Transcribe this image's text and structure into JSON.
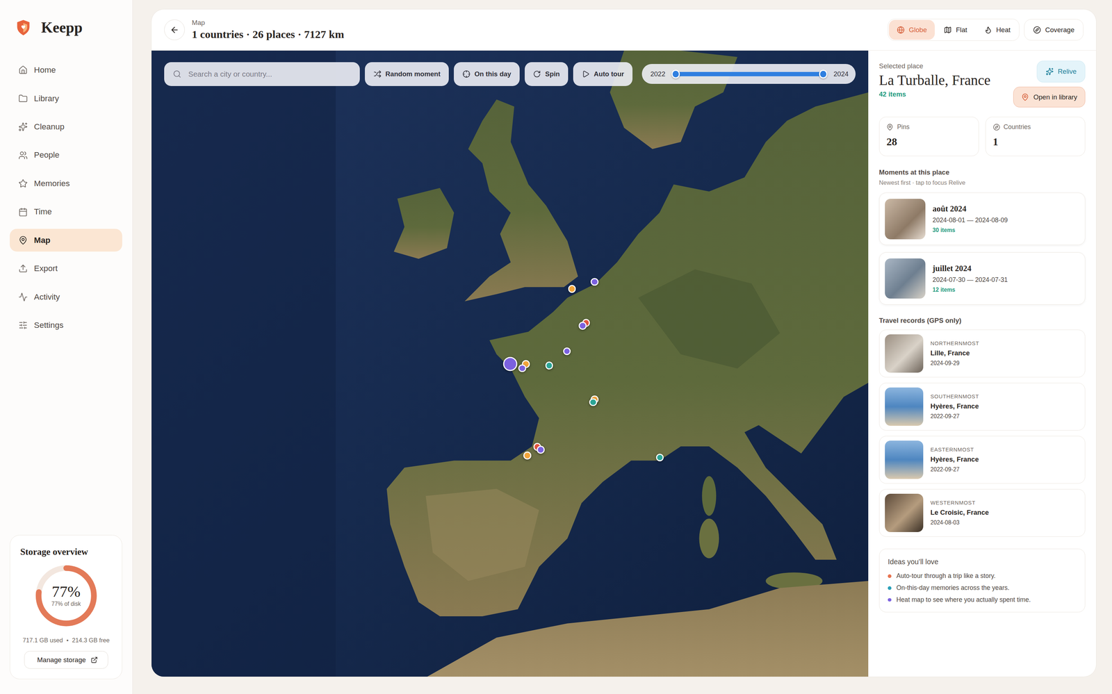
{
  "app": {
    "name": "Keepp"
  },
  "sidebar": {
    "items": [
      {
        "label": "Home",
        "selected": false
      },
      {
        "label": "Library",
        "selected": false
      },
      {
        "label": "Cleanup",
        "selected": false
      },
      {
        "label": "People",
        "selected": false
      },
      {
        "label": "Memories",
        "selected": false
      },
      {
        "label": "Time",
        "selected": false
      },
      {
        "label": "Map",
        "selected": true
      },
      {
        "label": "Export",
        "selected": false
      },
      {
        "label": "Activity",
        "selected": false
      },
      {
        "label": "Settings",
        "selected": false
      }
    ]
  },
  "storage": {
    "title": "Storage overview",
    "percent": "77%",
    "caption": "77% of disk",
    "level": 0.77,
    "used": "717.1 GB used",
    "separator": "•",
    "free": "214.3 GB free",
    "button": "Manage storage"
  },
  "header": {
    "eyebrow": "Map",
    "title": "1 countries · 26 places · 7127 km",
    "views": [
      {
        "label": "Globe",
        "selected": true
      },
      {
        "label": "Flat",
        "selected": false
      },
      {
        "label": "Heat",
        "selected": false
      }
    ],
    "coverage": "Coverage"
  },
  "map": {
    "search": {
      "placeholder": "Search a city or country..."
    },
    "actions": [
      "Random moment",
      "On this day",
      "Spin",
      "Auto tour"
    ],
    "range": {
      "from": "2022",
      "to": "2024",
      "low": 0.03,
      "high": 0.97
    },
    "pins": [
      {
        "color": "#f2a53a",
        "selected": false
      },
      {
        "color": "#7b61e0",
        "selected": false
      },
      {
        "color": "#e8553f",
        "selected": false
      },
      {
        "color": "#7b61e0",
        "selected": false
      },
      {
        "color": "#7b61e0",
        "selected": false
      },
      {
        "color": "#2ba596",
        "selected": false
      },
      {
        "color": "#f2a53a",
        "selected": false
      },
      {
        "color": "#7b61e0",
        "selected": false
      },
      {
        "color": "#7b61e0",
        "selected": true
      },
      {
        "color": "#f2a53a",
        "selected": false
      },
      {
        "color": "#2ba596",
        "selected": false
      },
      {
        "color": "#e8553f",
        "selected": false
      },
      {
        "color": "#7b61e0",
        "selected": false
      },
      {
        "color": "#f2a53a",
        "selected": false
      },
      {
        "color": "#2ba596",
        "selected": false
      }
    ]
  },
  "panel": {
    "eyebrow": "Selected place",
    "title": "La Turballe, France",
    "count": "42 items",
    "relive": "Relive",
    "open": "Open in library",
    "stats": [
      {
        "label": "Pins",
        "value": "28"
      },
      {
        "label": "Countries",
        "value": "1"
      }
    ],
    "moments": {
      "title": "Moments at this place",
      "subtitle": "Newest first · tap to focus Relive",
      "items": [
        {
          "title": "août 2024",
          "dates": "2024-08-01 — 2024-08-09",
          "count": "30 items"
        },
        {
          "title": "juillet 2024",
          "dates": "2024-07-30 — 2024-07-31",
          "count": "12 items"
        }
      ]
    },
    "records": {
      "title": "Travel records (GPS only)",
      "items": [
        {
          "label": "NORTHERNMOST",
          "place": "Lille, France",
          "date": "2024-09-29"
        },
        {
          "label": "SOUTHERNMOST",
          "place": "Hyères, France",
          "date": "2022-09-27"
        },
        {
          "label": "EASTERNMOST",
          "place": "Hyères, France",
          "date": "2022-09-27"
        },
        {
          "label": "WESTERNMOST",
          "place": "Le Croisic, France",
          "date": "2024-08-03"
        }
      ]
    },
    "ideas": {
      "title": "Ideas you’ll love",
      "items": [
        {
          "text": "Auto-tour through a trip like a story.",
          "color": "#e8734f"
        },
        {
          "text": "On-this-day memories across the years.",
          "color": "#2aa0b8"
        },
        {
          "text": "Heat map to see where you actually spent time.",
          "color": "#7b61e0"
        }
      ]
    }
  }
}
